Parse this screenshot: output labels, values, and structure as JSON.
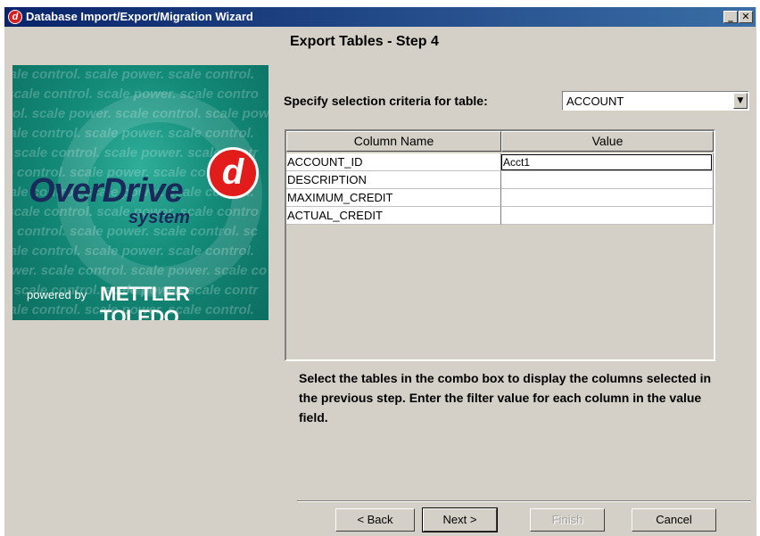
{
  "window": {
    "title": "Database Import/Export/Migration Wizard",
    "app_icon": "d-logo-icon",
    "minimize": "_",
    "close": "✕"
  },
  "step_title": "Export Tables - Step 4",
  "logo": {
    "watermark_text": "scale control. scale power. scale control. scale power.",
    "brand": "OverDrive",
    "brand_sub": "system",
    "badge": "d",
    "powered_by": "powered by",
    "company": "METTLER TOLEDO",
    "colors": {
      "teal": "#138a78",
      "red": "#e21b1b",
      "navy": "#1a2a5a"
    }
  },
  "criteria": {
    "label": "Specify selection criteria for table:",
    "selected_table": "ACCOUNT"
  },
  "grid": {
    "headers": [
      "Column Name",
      "Value"
    ],
    "rows": [
      {
        "name": "ACCOUNT_ID",
        "value": "Acct1"
      },
      {
        "name": "DESCRIPTION",
        "value": ""
      },
      {
        "name": "MAXIMUM_CREDIT",
        "value": ""
      },
      {
        "name": "ACTUAL_CREDIT",
        "value": ""
      }
    ]
  },
  "instructions": "Select the tables in the combo box to display the columns selected in the previous step. Enter the filter value for each column in the value field.",
  "buttons": {
    "back": "< Back",
    "next": "Next >",
    "finish": "Finish",
    "cancel": "Cancel"
  }
}
